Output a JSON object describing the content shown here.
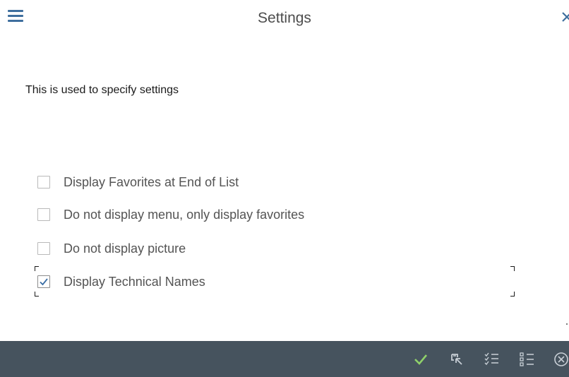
{
  "header": {
    "title": "Settings",
    "menu_icon": "hamburger-menu-icon",
    "close_icon": "close-icon"
  },
  "description": "This is used to specify settings",
  "options": [
    {
      "label": "Display Favorites at End of List",
      "checked": false
    },
    {
      "label": "Do not display menu, only display favorites",
      "checked": false
    },
    {
      "label": "Do not display picture",
      "checked": false
    },
    {
      "label": "Display Technical Names",
      "checked": true
    }
  ],
  "footer": {
    "buttons": [
      {
        "icon": "checkmark-icon",
        "color": "#8fd16a"
      },
      {
        "icon": "select-cursor-icon",
        "color": "#c8cfd6"
      },
      {
        "icon": "select-all-icon",
        "color": "#c8cfd6"
      },
      {
        "icon": "deselect-all-icon",
        "color": "#c8cfd6"
      },
      {
        "icon": "cancel-icon",
        "color": "#c8cfd6"
      }
    ]
  },
  "colors": {
    "accent": "#3f6f9e",
    "footer_background": "#46535e"
  }
}
